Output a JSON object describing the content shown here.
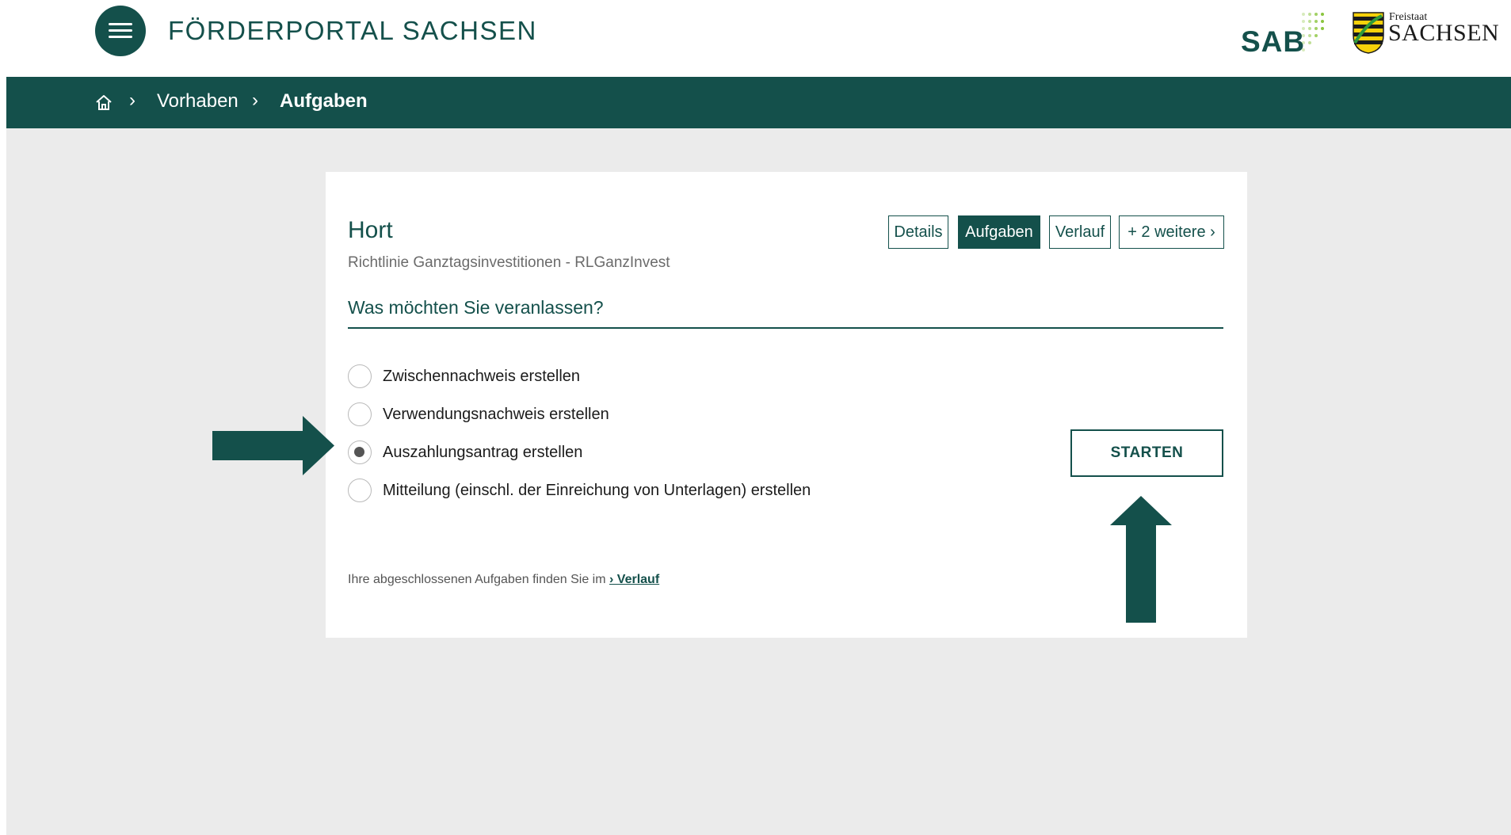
{
  "header": {
    "title": "FÖRDERPORTAL SACHSEN",
    "sab_logo_text": "SAB",
    "saxony_logo_top": "Freistaat",
    "saxony_logo_main": "SACHSEN",
    "brand_color": "#14504b",
    "accent_color": "#8bc53f"
  },
  "breadcrumb": {
    "home_icon": "home-icon",
    "separator": "›",
    "items": [
      {
        "label": "Vorhaben"
      },
      {
        "label": "Aufgaben"
      }
    ]
  },
  "card": {
    "title": "Hort",
    "subtitle": "Richtlinie Ganztagsinvestitionen - RLGanzInvest",
    "tabs": [
      {
        "label": "Details",
        "active": false
      },
      {
        "label": "Aufgaben",
        "active": true
      },
      {
        "label": "Verlauf",
        "active": false
      },
      {
        "label": "+ 2 weitere ›",
        "active": false
      }
    ],
    "question": "Was möchten Sie veranlassen?",
    "options": [
      {
        "label": "Zwischennachweis erstellen",
        "selected": false
      },
      {
        "label": "Verwendungsnachweis erstellen",
        "selected": false
      },
      {
        "label": "Auszahlungsantrag erstellen",
        "selected": true
      },
      {
        "label": "Mitteilung (einschl. der Einreichung von Unterlagen) erstellen",
        "selected": false
      }
    ],
    "start_button": "STARTEN",
    "footer_text": "Ihre abgeschlossenen Aufgaben finden Sie im",
    "footer_link": "› Verlauf"
  }
}
